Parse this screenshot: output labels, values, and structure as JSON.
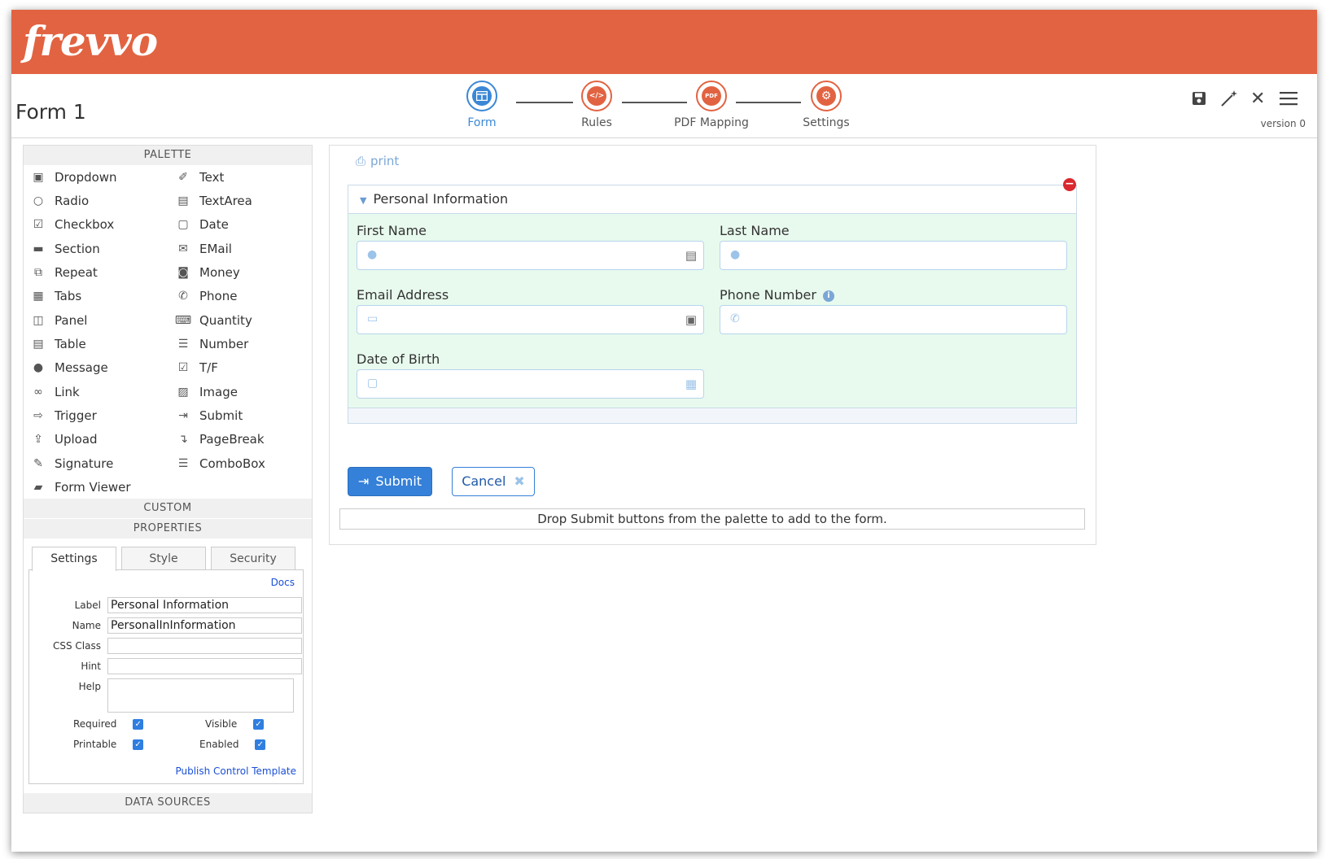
{
  "app": {
    "logo": "frevvo",
    "form_title": "Form 1"
  },
  "steps": [
    {
      "label": "Form",
      "icon": "form-icon",
      "active": true
    },
    {
      "label": "Rules",
      "icon": "code-icon",
      "active": false
    },
    {
      "label": "PDF Mapping",
      "icon": "pdf-icon",
      "active": false
    },
    {
      "label": "Settings",
      "icon": "gear-icon",
      "active": false
    }
  ],
  "step_badges": {
    "rules": "</>",
    "pdf": "PDF"
  },
  "toolbar": {
    "version": "version 0"
  },
  "palette": {
    "title": "PALETTE",
    "left": [
      {
        "label": "Dropdown",
        "icon": "dropdown-icon"
      },
      {
        "label": "Radio",
        "icon": "radio-icon"
      },
      {
        "label": "Checkbox",
        "icon": "checkbox-icon"
      },
      {
        "label": "Section",
        "icon": "folder-icon"
      },
      {
        "label": "Repeat",
        "icon": "repeat-icon"
      },
      {
        "label": "Tabs",
        "icon": "tabs-icon"
      },
      {
        "label": "Panel",
        "icon": "panel-icon"
      },
      {
        "label": "Table",
        "icon": "table-icon"
      },
      {
        "label": "Message",
        "icon": "message-icon"
      },
      {
        "label": "Link",
        "icon": "link-icon"
      },
      {
        "label": "Trigger",
        "icon": "trigger-icon"
      },
      {
        "label": "Upload",
        "icon": "upload-icon"
      },
      {
        "label": "Signature",
        "icon": "pencil-icon"
      },
      {
        "label": "Form Viewer",
        "icon": "book-icon"
      }
    ],
    "right": [
      {
        "label": "Text",
        "icon": "edit-icon"
      },
      {
        "label": "TextArea",
        "icon": "textarea-icon"
      },
      {
        "label": "Date",
        "icon": "calendar-icon"
      },
      {
        "label": "EMail",
        "icon": "envelope-icon"
      },
      {
        "label": "Money",
        "icon": "money-icon"
      },
      {
        "label": "Phone",
        "icon": "phone-icon"
      },
      {
        "label": "Quantity",
        "icon": "keyboard-icon"
      },
      {
        "label": "Number",
        "icon": "list-ol-icon"
      },
      {
        "label": "T/F",
        "icon": "check-square-icon"
      },
      {
        "label": "Image",
        "icon": "image-icon"
      },
      {
        "label": "Submit",
        "icon": "sign-in-icon"
      },
      {
        "label": "PageBreak",
        "icon": "pagebreak-icon"
      },
      {
        "label": "ComboBox",
        "icon": "list-icon"
      }
    ],
    "custom_title": "CUSTOM",
    "properties_title": "PROPERTIES",
    "data_sources_title": "DATA SOURCES"
  },
  "properties": {
    "tabs": [
      "Settings",
      "Style",
      "Security"
    ],
    "docs_link": "Docs",
    "fields": [
      {
        "label": "Label",
        "value": "Personal Information"
      },
      {
        "label": "Name",
        "value": "PersonalInInformation"
      },
      {
        "label": "CSS Class",
        "value": ""
      },
      {
        "label": "Hint",
        "value": ""
      }
    ],
    "help_label": "Help",
    "required_label": "Required",
    "visible_label": "Visible",
    "printable_label": "Printable",
    "enabled_label": "Enabled",
    "publish_link": "Publish Control Template"
  },
  "canvas": {
    "print_label": "print",
    "section_title": "Personal Information",
    "fields": {
      "first_name": "First Name",
      "last_name": "Last Name",
      "email": "Email Address",
      "phone": "Phone Number",
      "dob": "Date of Birth"
    },
    "submit_label": "Submit",
    "cancel_label": "Cancel",
    "drop_hint": "Drop Submit buttons from the palette to add to the form."
  },
  "colors": {
    "brand": "#e26341",
    "accent": "#3b87d6",
    "section_bg": "#e8faee"
  }
}
